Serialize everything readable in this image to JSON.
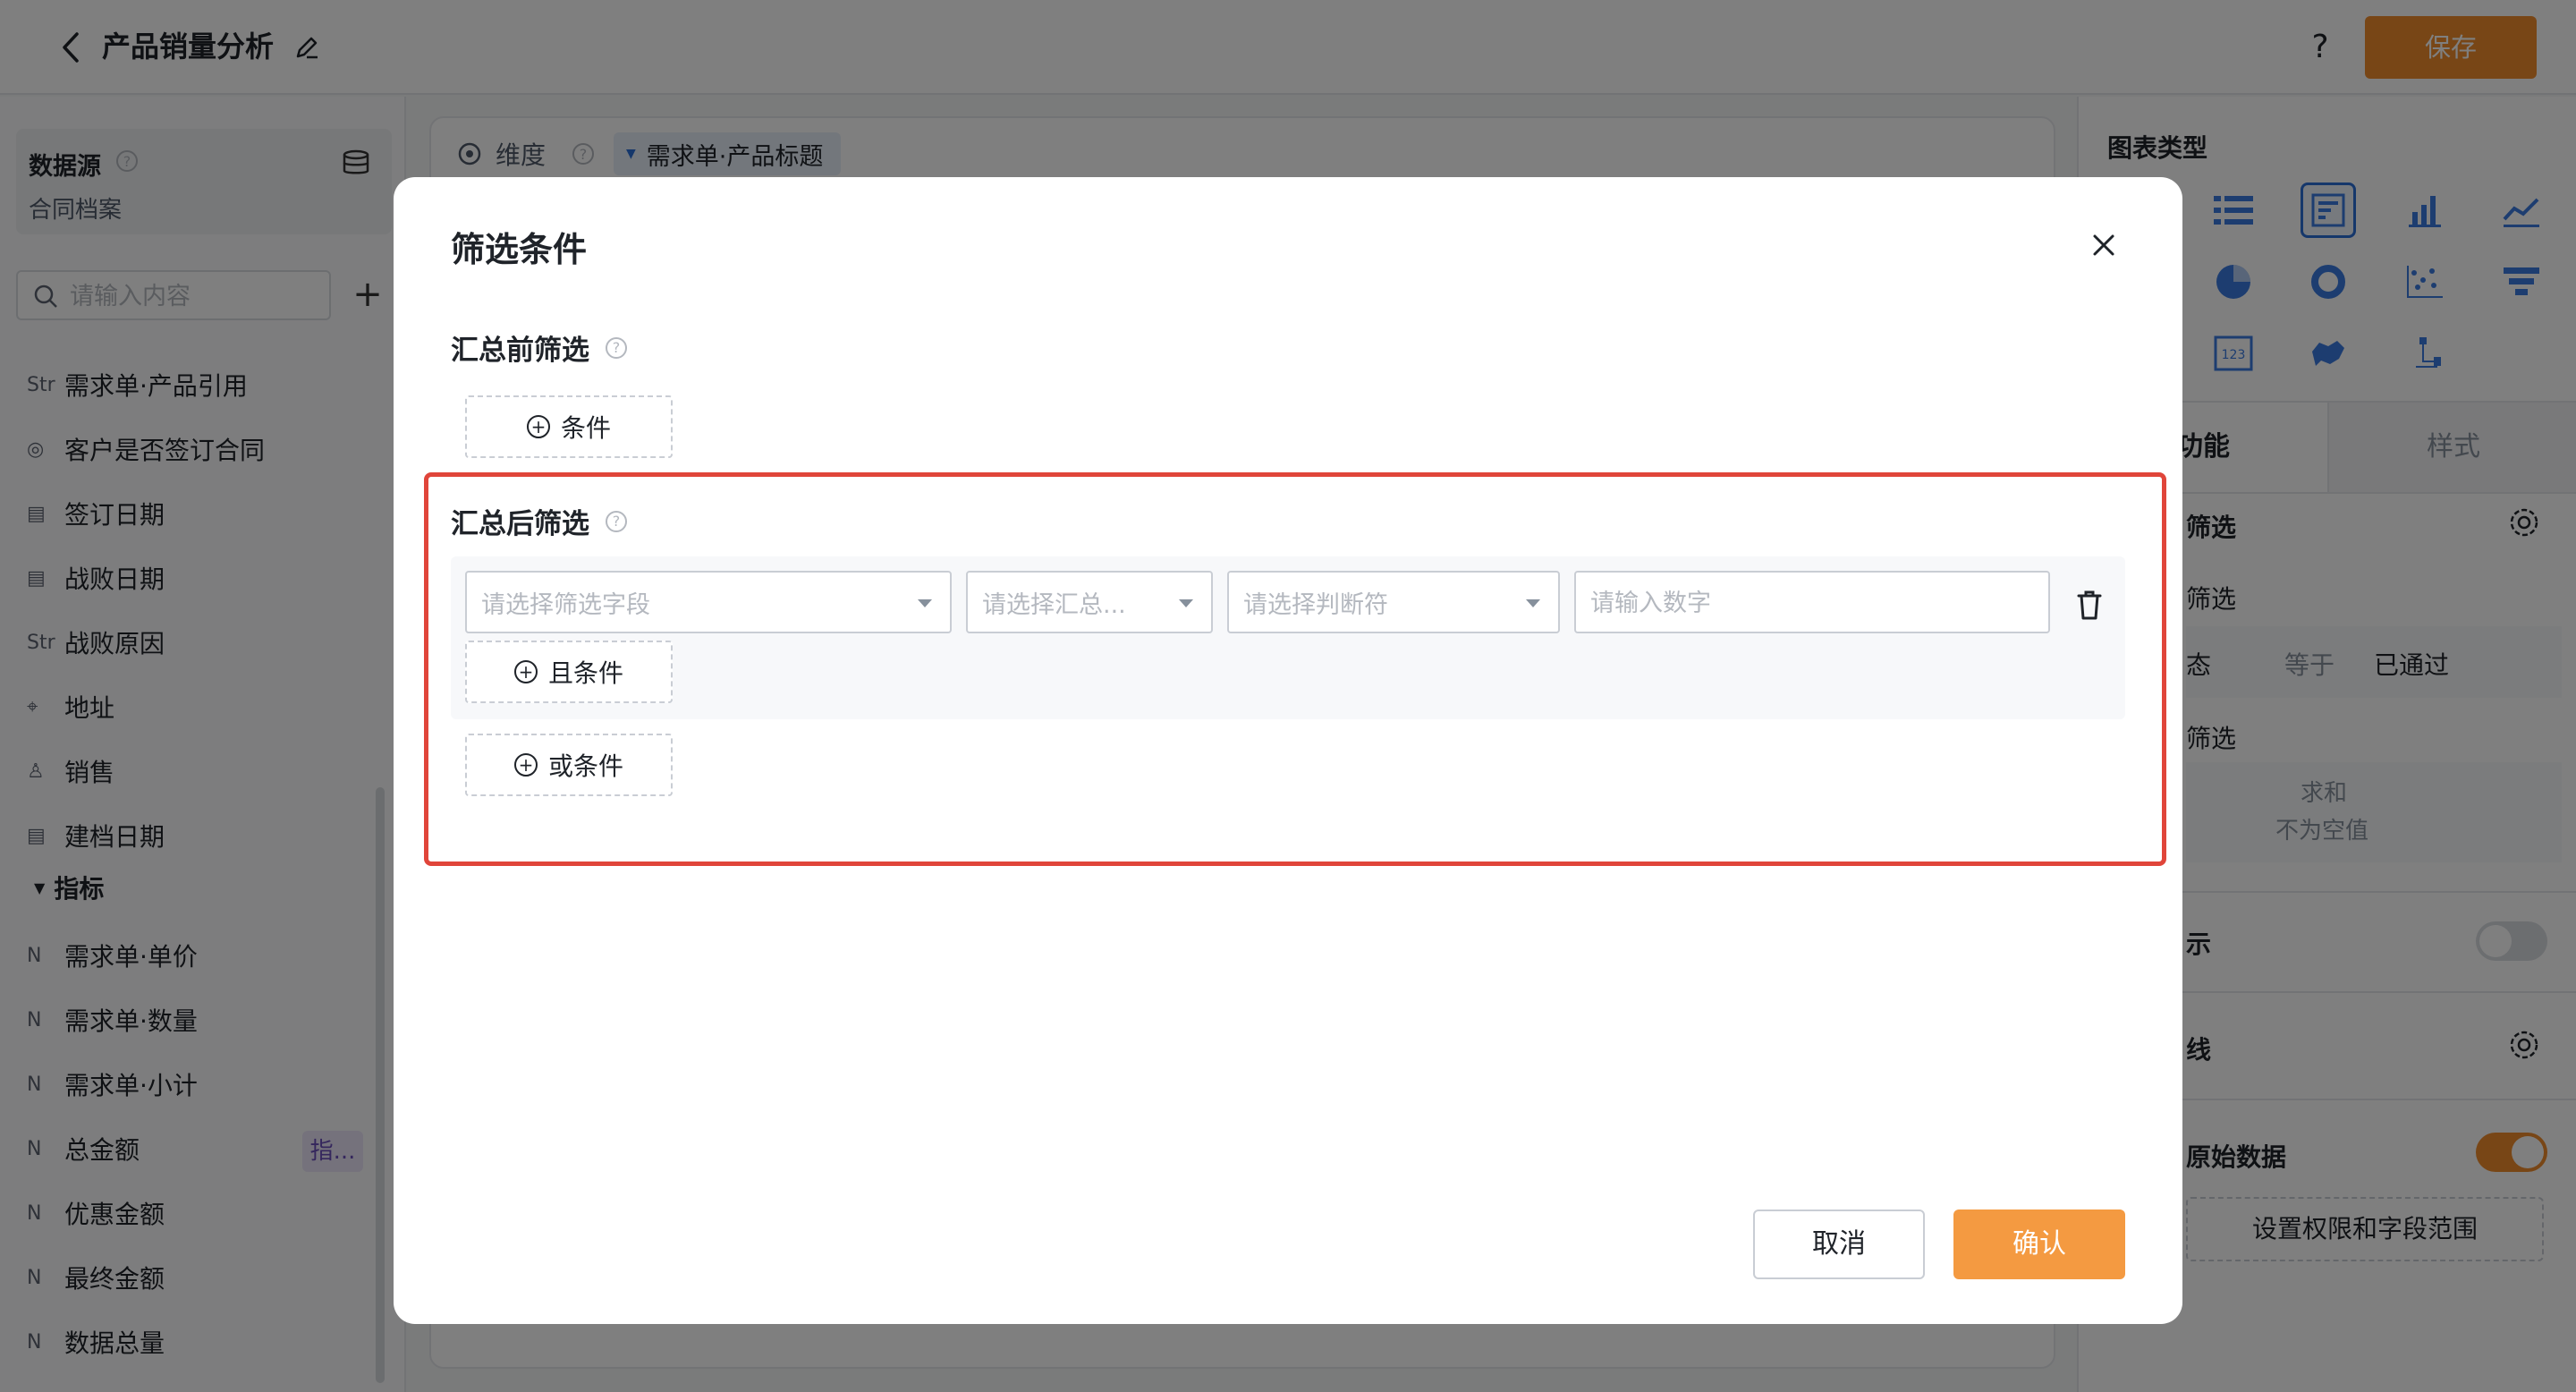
{
  "header": {
    "title": "产品销量分析",
    "save_label": "保存",
    "help_label": "?"
  },
  "left_panel": {
    "datasource_label": "数据源",
    "datasource_name": "合同档案",
    "search_placeholder": "请输入内容",
    "add_label": "+",
    "dimension_fields": [
      {
        "icon": "Str",
        "label": "需求单·产品引用"
      },
      {
        "icon": "◎",
        "label": "客户是否签订合同"
      },
      {
        "icon": "▤",
        "label": "签订日期"
      },
      {
        "icon": "▤",
        "label": "战败日期"
      },
      {
        "icon": "Str",
        "label": "战败原因"
      },
      {
        "icon": "⌖",
        "label": "地址"
      },
      {
        "icon": "♙",
        "label": "销售"
      },
      {
        "icon": "▤",
        "label": "建档日期"
      }
    ],
    "indicators_title": "指标",
    "indicator_fields": [
      {
        "icon": "N",
        "label": "需求单·单价"
      },
      {
        "icon": "N",
        "label": "需求单·数量"
      },
      {
        "icon": "N",
        "label": "需求单·小计"
      },
      {
        "icon": "N",
        "label": "总金额"
      },
      {
        "icon": "N",
        "label": "优惠金额"
      },
      {
        "icon": "N",
        "label": "最终金额"
      },
      {
        "icon": "N",
        "label": "数据总量"
      }
    ],
    "indicator_badge": "指..."
  },
  "center": {
    "dimension_label": "维度",
    "dimension_tag": "需求单·产品标题"
  },
  "right_panel": {
    "chart_type_title": "图表类型",
    "tab_function": "功能",
    "tab_style": "样式",
    "filter_label": "筛选",
    "pre_filter_label": "筛选",
    "status_label": "态",
    "equals_label": "等于",
    "approved_label": "已通过",
    "post_filter_label": "筛选",
    "sum_label": "求和",
    "not_empty_label": "不为空值",
    "display_label": "示",
    "line_label": "线",
    "raw_data_label": "原始数据",
    "perm_button": "设置权限和字段范围",
    "accent": "#f08c2d"
  },
  "dialog": {
    "title": "筛选条件",
    "pre_agg_title": "汇总前筛选",
    "add_condition": "条件",
    "post_agg_title": "汇总后筛选",
    "field_placeholder": "请选择筛选字段",
    "agg_placeholder": "请选择汇总...",
    "operator_placeholder": "请选择判断符",
    "number_placeholder": "请输入数字",
    "and_condition": "且条件",
    "or_condition": "或条件",
    "cancel_label": "取消",
    "confirm_label": "确认",
    "highlight_color": "#e0453a"
  }
}
